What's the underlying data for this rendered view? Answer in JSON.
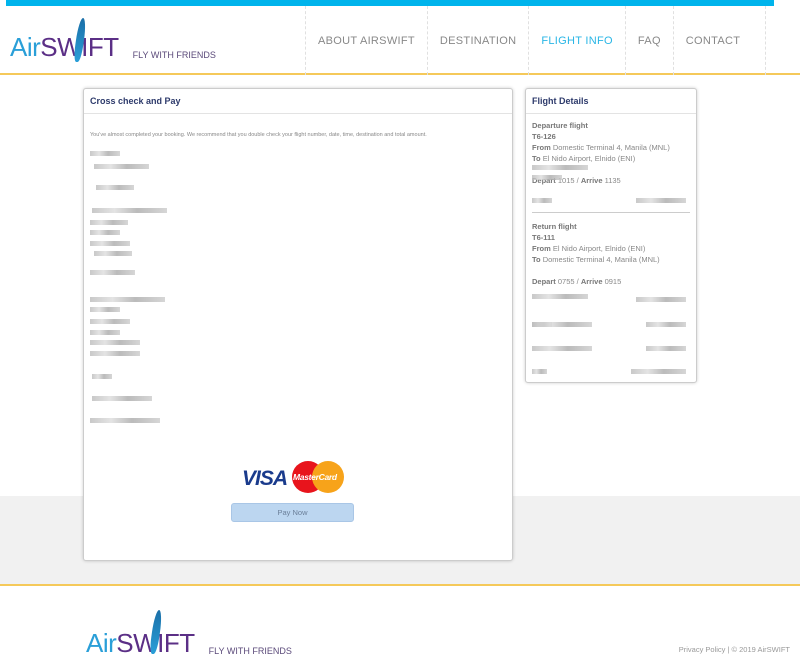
{
  "header": {
    "logo_air": "Air",
    "logo_swift": "SWIFT",
    "tagline": "FLY WITH FRIENDS",
    "nav": [
      {
        "label": "ABOUT AIRSWIFT",
        "active": false
      },
      {
        "label": "DESTINATION",
        "active": false
      },
      {
        "label": "FLIGHT INFO",
        "active": true
      },
      {
        "label": "FAQ",
        "active": false
      },
      {
        "label": "CONTACT",
        "active": false
      }
    ]
  },
  "main": {
    "title": "Cross check and Pay",
    "intro": "You've almost completed your booking. We recommend that you double check your flight number, date, time, destination and total amount.",
    "card_brands": {
      "visa": "VISA",
      "mastercard": "MasterCard"
    },
    "pay_label": "Pay Now"
  },
  "flight_details": {
    "title": "Flight Details",
    "departure": {
      "heading": "Departure flight",
      "number": "T6-126",
      "from_label": "From",
      "from": "Domestic Terminal 4, Manila (MNL)",
      "to_label": "To",
      "to": "El Nido Airport, Elnido (ENI)",
      "depart_label": "Depart",
      "depart": "1015",
      "arrive_label": "Arrive",
      "arrive": "1135"
    },
    "return": {
      "heading": "Return flight",
      "number": "T6-111",
      "from_label": "From",
      "from": "El Nido Airport, Elnido (ENI)",
      "to_label": "To",
      "to": "Domestic Terminal 4, Manila (MNL)",
      "depart_label": "Depart",
      "depart": "0755",
      "arrive_label": "Arrive",
      "arrive": "0915"
    }
  },
  "footer": {
    "logo_air": "Air",
    "logo_swift": "SWIFT",
    "tagline": "FLY WITH FRIENDS",
    "copyright": "Privacy Policy | © 2019 AirSWIFT"
  },
  "colors": {
    "accent": "#00b4ec",
    "divider": "#f5c95a",
    "brand_purple": "#5b2f86",
    "title": "#2d3a6b"
  }
}
